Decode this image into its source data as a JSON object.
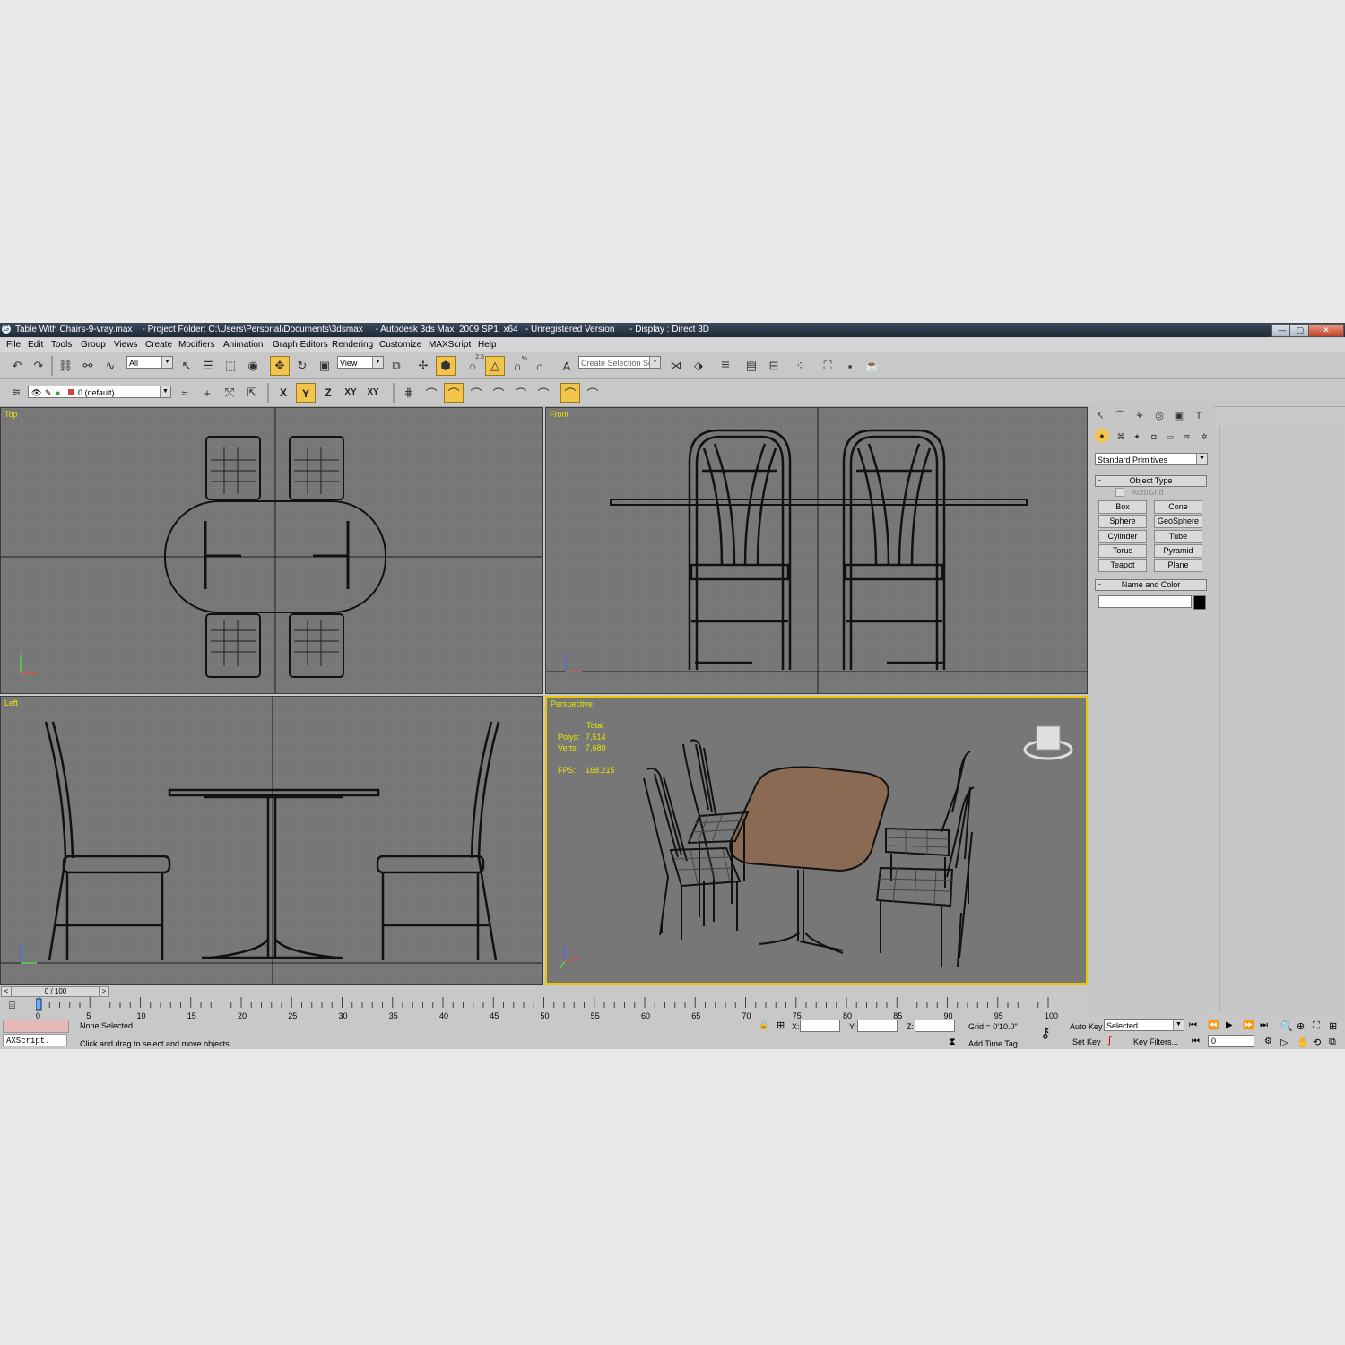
{
  "window": {
    "title": "Table With Chairs-9-vray.max    - Project Folder: C:\\Users\\Personal\\Documents\\3dsmax     - Autodesk 3ds Max  2009 SP1  x64   - Unregistered Version      - Display : Direct 3D",
    "minimize": "—",
    "maximize": "▢",
    "close": "✕"
  },
  "menu": [
    "File",
    "Edit",
    "Tools",
    "Group",
    "Views",
    "Create",
    "Modifiers",
    "Animation",
    "Graph Editors",
    "Rendering",
    "Customize",
    "MAXScript",
    "Help"
  ],
  "toolbar": {
    "selection_filter": "All",
    "ref_coord": "View",
    "named_selection_placeholder": "Create Selection Set",
    "snap_angle_label": "2.5",
    "snap_pct_label": "%"
  },
  "layers": {
    "current_layer": "0 (default)",
    "axis_x": "X",
    "axis_y": "Y",
    "axis_z": "Z",
    "axis_xy": "XY",
    "axis_xy2": "XY"
  },
  "viewports": {
    "top": {
      "label": "Top"
    },
    "front": {
      "label": "Front"
    },
    "left": {
      "label": "Left"
    },
    "perspective": {
      "label": "Perspective",
      "stats_total": "Total",
      "polys_label": "Polys:",
      "polys_value": "7,514",
      "verts_label": "Verts:",
      "verts_value": "7,680",
      "fps_label": "FPS:",
      "fps_value": "168.215"
    },
    "table_color": "#8a6a52",
    "active_border": "#e9c700"
  },
  "command_panel": {
    "category_dropdown": "Standard Primitives",
    "object_type_header": "Object Type",
    "autogrid_label": "AutoGrid",
    "buttons": [
      "Box",
      "Cone",
      "Sphere",
      "GeoSphere",
      "Cylinder",
      "Tube",
      "Torus",
      "Pyramid",
      "Teapot",
      "Plane"
    ],
    "name_color_header": "Name and Color",
    "name_value": "",
    "swatch_color": "#000000"
  },
  "timeline": {
    "frame_counter": "0 / 100",
    "prev": "<",
    "next": ">",
    "ticks": [
      "0",
      "5",
      "10",
      "15",
      "20",
      "25",
      "30",
      "35",
      "40",
      "45",
      "50",
      "55",
      "60",
      "65",
      "70",
      "75",
      "80",
      "85",
      "90",
      "95",
      "100"
    ]
  },
  "status": {
    "maxscript_label": "AXScript.",
    "selection_status": "None Selected",
    "prompt": "Click and drag to select and move objects",
    "x_label": "X:",
    "y_label": "Y:",
    "z_label": "Z:",
    "x_value": "",
    "y_value": "",
    "z_value": "",
    "grid": "Grid = 0'10.0\"",
    "add_time_tag": "Add Time Tag",
    "auto_key": "Auto Key",
    "set_key": "Set Key",
    "key_mode": "Selected",
    "key_filters": "Key Filters...",
    "current_frame": "0"
  }
}
